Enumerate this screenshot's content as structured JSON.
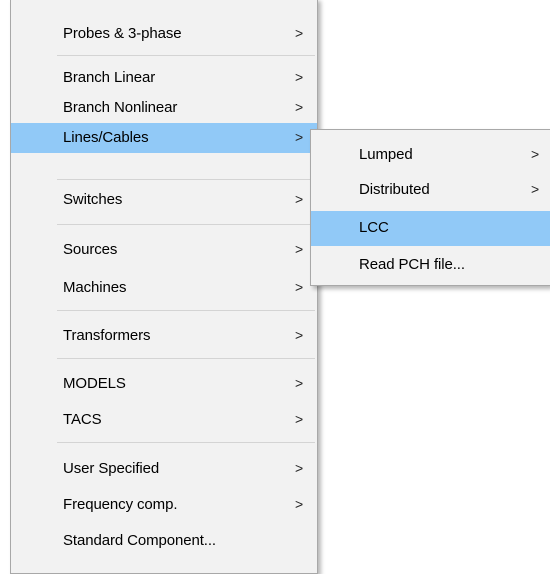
{
  "main_menu": {
    "items": [
      {
        "label": "Probes & 3-phase",
        "arrow": ">"
      },
      {
        "label": "Branch Linear",
        "arrow": ">"
      },
      {
        "label": "Branch Nonlinear",
        "arrow": ">"
      },
      {
        "label": "Lines/Cables",
        "arrow": ">",
        "highlighted": true
      },
      {
        "label": "Switches",
        "arrow": ">"
      },
      {
        "label": "Sources",
        "arrow": ">"
      },
      {
        "label": "Machines",
        "arrow": ">"
      },
      {
        "label": "Transformers",
        "arrow": ">"
      },
      {
        "label": "MODELS",
        "arrow": ">"
      },
      {
        "label": "TACS",
        "arrow": ">"
      },
      {
        "label": "User Specified",
        "arrow": ">"
      },
      {
        "label": "Frequency comp.",
        "arrow": ">"
      },
      {
        "label": "Standard Component..."
      }
    ]
  },
  "sub_menu": {
    "items": [
      {
        "label": "Lumped",
        "arrow": ">"
      },
      {
        "label": "Distributed",
        "arrow": ">"
      },
      {
        "label": "LCC",
        "highlighted": true
      },
      {
        "label": "Read PCH file..."
      }
    ]
  },
  "colors": {
    "highlight": "#91c9f7",
    "menu_bg": "#f2f2f2",
    "border": "#a8a8a8"
  }
}
